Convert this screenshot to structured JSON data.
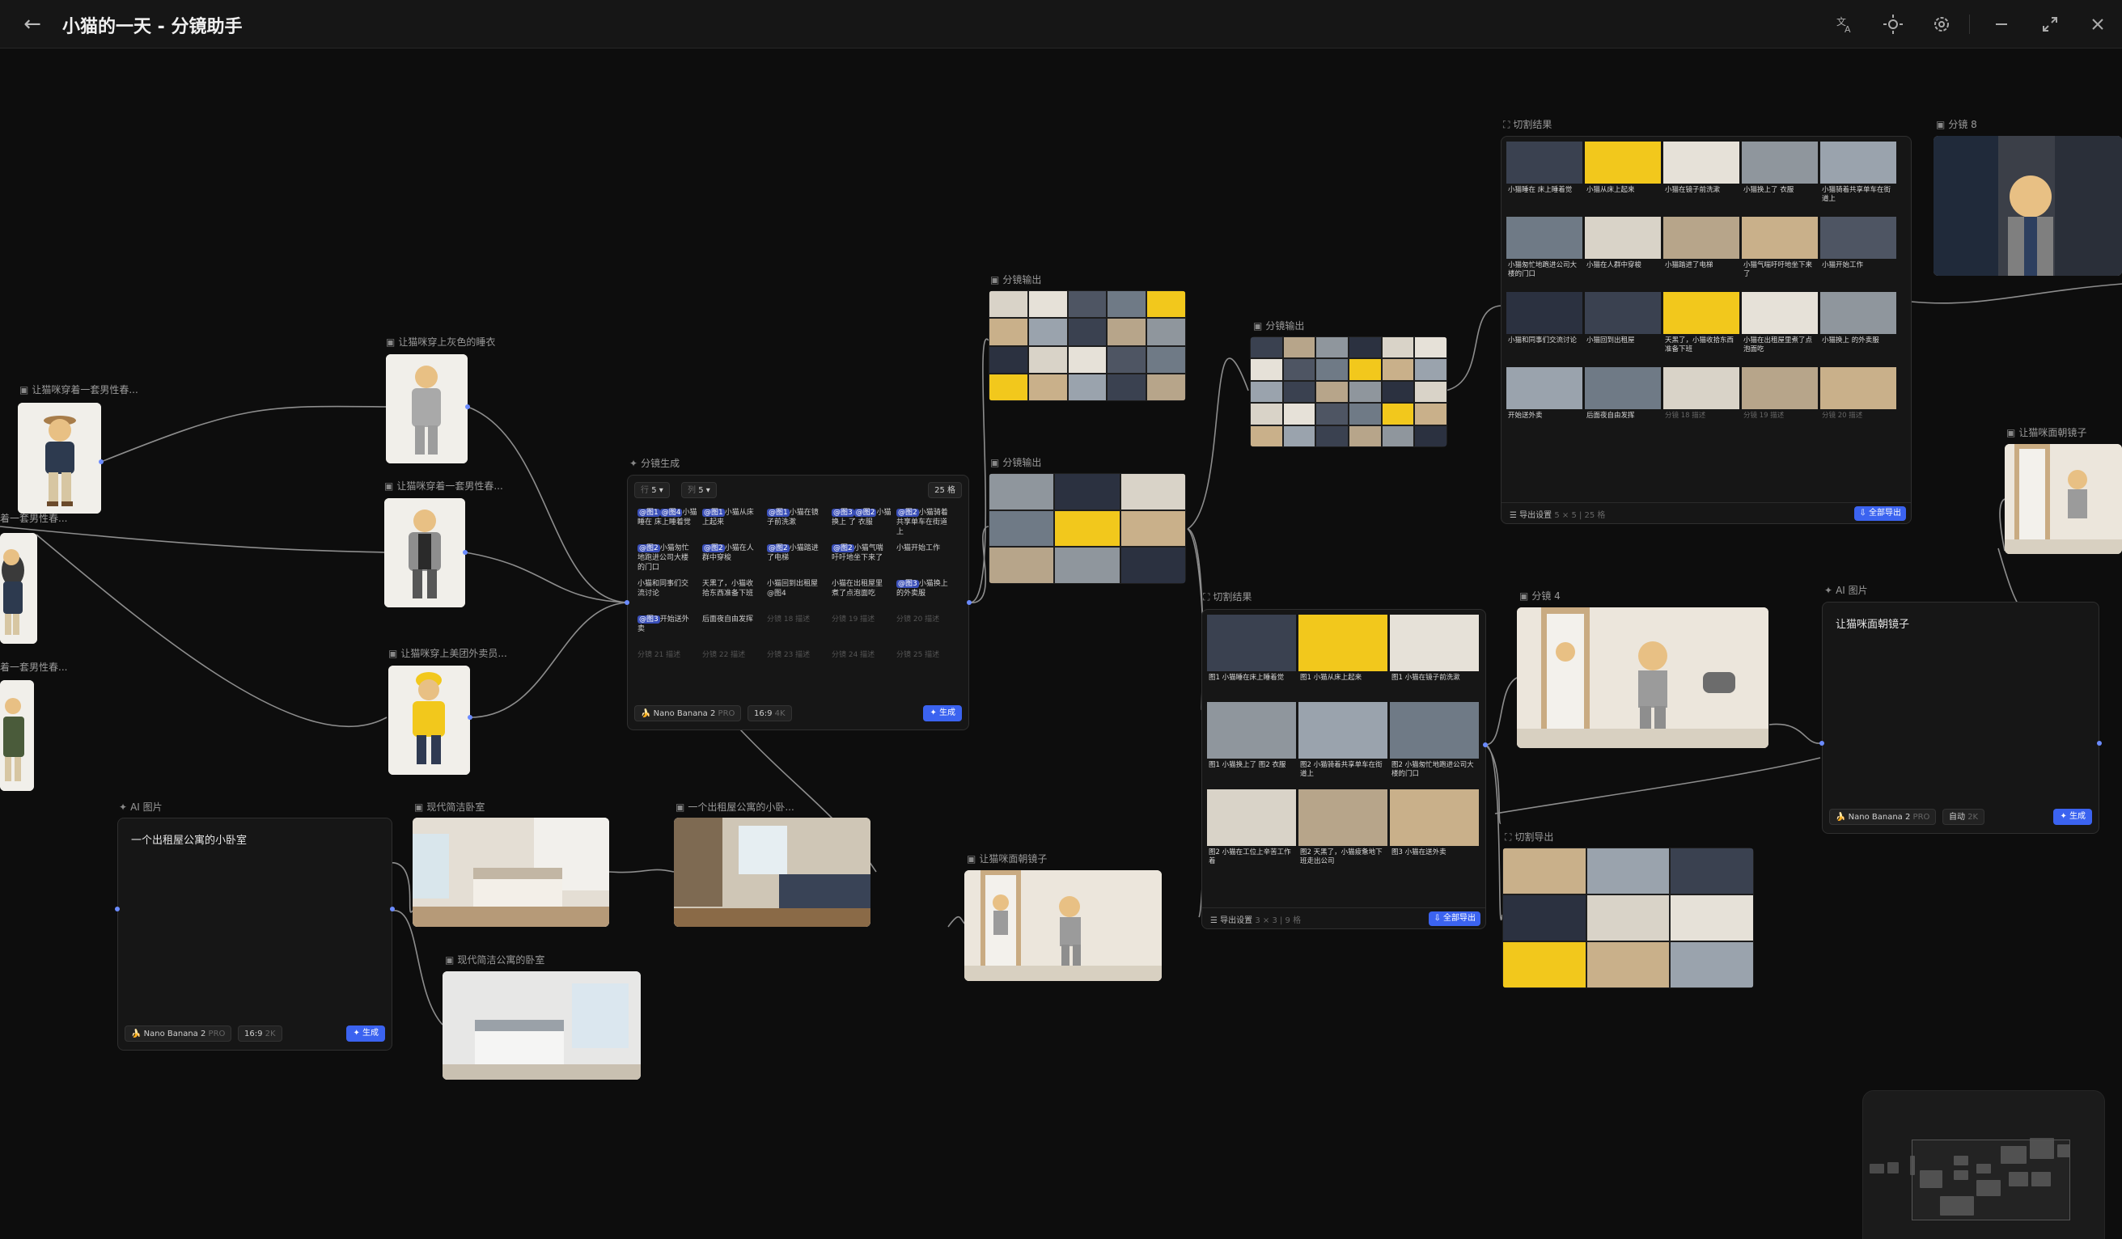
{
  "window": {
    "title": "小猫的一天 - 分镜助手",
    "back_icon": "arrow-left-icon",
    "actions": [
      "translate-icon",
      "sun-icon",
      "gear-icon",
      "minimize-icon",
      "maximize-icon",
      "close-icon"
    ]
  },
  "nodes": {
    "cat_outfit_left": "让猫咪穿着一套男性春...",
    "cat_outfit_left2": "着一套男性春...",
    "cat_outfit_left3": "着一套男性春...",
    "cat_grey_pajamas": "让猫咪穿上灰色的睡衣",
    "cat_outfit_male": "让猫咪穿着一套男性春...",
    "cat_delivery": "让猫咪穿上美团外卖员...",
    "ai_image_1": {
      "label": "AI 图片",
      "prompt": "一个出租屋公寓的小卧室",
      "model": "Nano Banana 2",
      "model_tier": "PRO",
      "ratio": "16:9",
      "res": "2K",
      "generate": "生成"
    },
    "modern_bedroom": "现代简洁卧室",
    "modern_apartment_bedroom": "现代简洁公寓的卧室",
    "small_room": "一个出租屋公寓的小卧...",
    "storyboard_gen": {
      "label": "分镜生成",
      "rows_label": "行",
      "rows": "5",
      "cols_label": "列",
      "cols": "5",
      "count": "25 格",
      "cells": [
        {
          "tags": [
            "@图1",
            "@图4"
          ],
          "text": "小猫睡在 床上睡着觉"
        },
        {
          "tags": [
            "@图1"
          ],
          "text": "小猫从床 上起来"
        },
        {
          "tags": [
            "@图1"
          ],
          "text": "小猫在镜 子前洗漱"
        },
        {
          "tags": [
            "@图3",
            "@图2"
          ],
          "text": "小猫换上 了 衣服"
        },
        {
          "tags": [
            "@图2"
          ],
          "text": "小猫骑着 共享单车在街道 上"
        },
        {
          "tags": [
            "@图2"
          ],
          "text": "小猫匆忙 地跑进公司大楼 的门口"
        },
        {
          "tags": [
            "@图2"
          ],
          "text": "小猫在人 群中穿梭"
        },
        {
          "tags": [
            "@图2"
          ],
          "text": "小猫踏进 了电梯"
        },
        {
          "tags": [
            "@图2"
          ],
          "text": "小猫气喘 吁吁地坐下来了"
        },
        {
          "tags": [],
          "text": "小猫开始工作"
        },
        {
          "tags": [],
          "text": "小猫和同事们交 流讨论"
        },
        {
          "tags": [],
          "text": "天黑了，小猫收 拾东西准备下班"
        },
        {
          "tags": [],
          "text": "小猫回到出租屋 @图4"
        },
        {
          "tags": [],
          "text": "小猫在出租屋里 煮了点泡面吃"
        },
        {
          "tags": [
            "@图3"
          ],
          "text": "小猫换上 的外卖服"
        },
        {
          "tags": [
            "@图3"
          ],
          "text": "开始送外 卖"
        },
        {
          "tags": [],
          "text": "后面夜自由发挥"
        },
        {
          "tags": [],
          "text": "分镜 18 描述",
          "faint": true
        },
        {
          "tags": [],
          "text": "分镜 19 描述",
          "faint": true
        },
        {
          "tags": [],
          "text": "分镜 20 描述",
          "faint": true
        },
        {
          "tags": [],
          "text": "分镜 21 描述",
          "faint": true
        },
        {
          "tags": [],
          "text": "分镜 22 描述",
          "faint": true
        },
        {
          "tags": [],
          "text": "分镜 23 描述",
          "faint": true
        },
        {
          "tags": [],
          "text": "分镜 24 描述",
          "faint": true
        },
        {
          "tags": [],
          "text": "分镜 25 描述",
          "faint": true
        }
      ],
      "model": "Nano Banana 2",
      "model_tier": "PRO",
      "ratio": "16:9",
      "res": "4K",
      "generate": "生成"
    },
    "sb_output_1": "分镜输出",
    "sb_output_2": "分镜输出",
    "sb_output_3": "分镜输出",
    "cat_mirror": "让猫咪面朝镜子",
    "cut_result_center": {
      "label": "切割结果",
      "caps": [
        "图1 小猫睡在床上睡着觉",
        "图1 小猫从床上起来",
        "图1 小猫在镜子前洗漱",
        "图1 小猫换上了 图2 衣服",
        "图2 小猫骑着共享单车在街道上",
        "图2 小猫匆忙地跑进公司大楼的门口",
        "图2 小猫在工位上辛苦工作着",
        "图2 天黑了，小猫疲惫地下班走出公司",
        "图3 小猫在送外卖"
      ],
      "export_settings": "导出设置",
      "grid_info": "3 × 3 | 9 格",
      "export_all": "全部导出"
    },
    "cut_result_top": {
      "label": "切割结果",
      "caps": [
        "小猫睡在 床上睡着觉",
        "小猫从床上起来",
        "小猫在镜子前洗漱",
        "小猫换上了 衣服",
        "小猫骑着共享单车在街道上",
        "小猫匆忙地跑进公司大楼的门口",
        "小猫在人群中穿梭",
        "小猫踏进了电梯",
        "小猫气喘吁吁地坐下来了",
        "小猫开始工作",
        "小猫和同事们交流讨论",
        "小猫回到出租屋",
        "天黑了，小猫收拾东西准备下班",
        "小猫在出租屋里煮了点泡面吃",
        "小猫换上 的外卖服",
        "开始送外卖",
        "后面夜自由发挥",
        "分镜 18 描述",
        "分镜 19 描述",
        "分镜 20 描述"
      ],
      "export_settings": "导出设置",
      "grid_info": "5 × 5 | 25 格",
      "export_all": "全部导出"
    },
    "storyboard_8": "分镜 8",
    "storyboard_4": "分镜 4",
    "cat_mirror_2": "让猫咪面朝镜子",
    "ai_image_2": {
      "label": "AI 图片",
      "prompt": "让猫咪面朝镜子",
      "model": "Nano Banana 2",
      "model_tier": "PRO",
      "ratio": "自动",
      "res": "2K",
      "generate": "生成"
    },
    "cut_export": "切割导出"
  },
  "colors": {
    "accent": "#3b63f0",
    "port": "#6b8bff",
    "wire": "#b8b8b8",
    "canvas": "#0d0d0d",
    "panel": "#161616"
  }
}
